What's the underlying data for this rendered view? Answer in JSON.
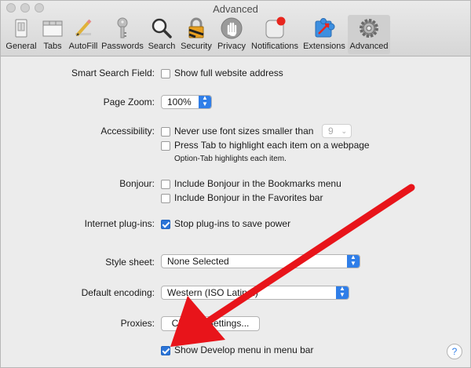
{
  "window": {
    "title": "Advanced"
  },
  "toolbar": {
    "items": [
      {
        "label": "General",
        "icon": "general-icon"
      },
      {
        "label": "Tabs",
        "icon": "tabs-icon"
      },
      {
        "label": "AutoFill",
        "icon": "autofill-icon"
      },
      {
        "label": "Passwords",
        "icon": "key-icon"
      },
      {
        "label": "Search",
        "icon": "magnifier-icon"
      },
      {
        "label": "Security",
        "icon": "lock-icon"
      },
      {
        "label": "Privacy",
        "icon": "hand-icon"
      },
      {
        "label": "Notifications",
        "icon": "notification-badge-icon"
      },
      {
        "label": "Extensions",
        "icon": "puzzle-icon"
      },
      {
        "label": "Advanced",
        "icon": "gear-icon",
        "active": true
      }
    ]
  },
  "settings": {
    "smart_search": {
      "label": "Smart Search Field:",
      "option": "Show full website address",
      "checked": false
    },
    "page_zoom": {
      "label": "Page Zoom:",
      "value": "100%"
    },
    "accessibility": {
      "label": "Accessibility:",
      "font_option": "Never use font sizes smaller than",
      "font_size_value": "9",
      "tab_option": "Press Tab to highlight each item on a webpage",
      "hint": "Option-Tab highlights each item."
    },
    "bonjour": {
      "label": "Bonjour:",
      "bookmarks_option": "Include Bonjour in the Bookmarks menu",
      "favorites_option": "Include Bonjour in the Favorites bar"
    },
    "plugins": {
      "label": "Internet plug-ins:",
      "option": "Stop plug-ins to save power",
      "checked": true
    },
    "style_sheet": {
      "label": "Style sheet:",
      "value": "None Selected"
    },
    "encoding": {
      "label": "Default encoding:",
      "value": "Western (ISO Latin 1)"
    },
    "proxies": {
      "label": "Proxies:",
      "button": "Change Settings..."
    },
    "develop_menu": {
      "option": "Show Develop menu in menu bar",
      "checked": true
    }
  },
  "help": {
    "label": "?"
  },
  "colors": {
    "accent": "#2f7ee8",
    "annotation_arrow": "#e8141a",
    "window_bg": "#ececec"
  }
}
